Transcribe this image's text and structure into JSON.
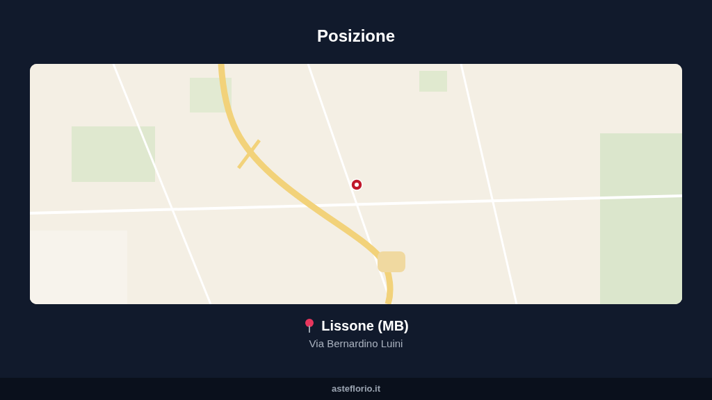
{
  "title": "Posizione",
  "location": {
    "name": "Lissone (MB)",
    "address": "Via Bernardino Luini"
  },
  "footer": {
    "site": "asteflorio.it"
  }
}
